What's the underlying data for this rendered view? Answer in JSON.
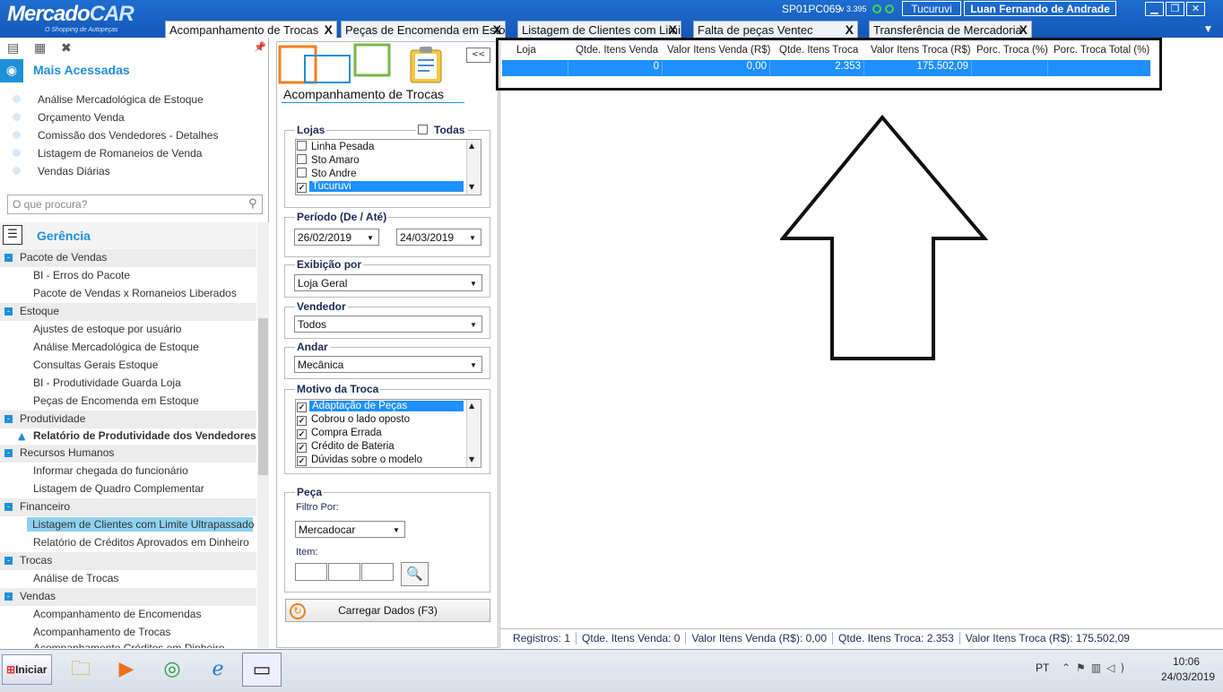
{
  "app": {
    "logo_main": "Mercado",
    "logo_car": "CAR",
    "logo_sub": "O Shopping de Autopeças"
  },
  "titlebar": {
    "pc_name": "SP01PC069",
    "version": "v 3.395",
    "store": "Tucuruvi",
    "user": "Luan Fernando de Andrade"
  },
  "tabs": [
    {
      "label": "Acompanhamento de Trocas",
      "active": true
    },
    {
      "label": "Peças de Encomenda em Estoq",
      "active": false
    },
    {
      "label": "Listagem de Clientes com Limi",
      "active": false
    },
    {
      "label": "Falta de peças Ventec",
      "active": false
    },
    {
      "label": "Transferência de Mercadoria",
      "active": false
    }
  ],
  "sidebar": {
    "most_accessed_title": "Mais Acessadas",
    "favorites": [
      "Análise Mercadológica de Estoque",
      "Orçamento Venda",
      "Comissão dos Vendedores - Detalhes",
      "Listagem de Romaneios de Venda",
      "Vendas Diárias"
    ],
    "search_placeholder": "O que procura?",
    "section_title": "Gerência",
    "groups": [
      {
        "name": "Pacote de Vendas",
        "items": [
          "BI - Erros do Pacote",
          "Pacote de Vendas x Romaneios Liberados"
        ]
      },
      {
        "name": "Estoque",
        "items": [
          "Ajustes de estoque por usuário",
          "Análise Mercadológica de Estoque",
          "Consultas Gerais Estoque",
          "BI - Produtividade Guarda Loja",
          "Peças de Encomenda em Estoque"
        ]
      },
      {
        "name": "Produtividade",
        "items": [
          "Relatório de Produtividade dos Vendedores"
        ]
      },
      {
        "name": "Recursos Humanos",
        "items": [
          "Informar chegada do funcionário",
          "Listagem de Quadro Complementar"
        ]
      },
      {
        "name": "Financeiro",
        "items": [
          "Listagem de Clientes com Limite Ultrapassado",
          "Relatório de Créditos Aprovados em Dinheiro"
        ]
      },
      {
        "name": "Trocas",
        "items": [
          "Análise de Trocas"
        ]
      },
      {
        "name": "Vendas",
        "items": [
          "Acompanhamento de Encomendas",
          "Acompanhamento de Trocas",
          "Acompanhamento Créditos em Dinheiro"
        ]
      }
    ]
  },
  "filters": {
    "title": "Acompanhamento de Trocas",
    "collapse_label": "<<",
    "stores_label": "Lojas",
    "all_label": "Todas",
    "stores": [
      {
        "name": "Linha Pesada",
        "checked": false
      },
      {
        "name": "Sto Amaro",
        "checked": false
      },
      {
        "name": "Sto Andre",
        "checked": false
      },
      {
        "name": "Tucuruvi",
        "checked": true
      }
    ],
    "period_label": "Período (De / Até)",
    "date_from": "26/02/2019",
    "date_to": "24/03/2019",
    "display_label": "Exibição por",
    "display_value": "Loja Geral",
    "seller_label": "Vendedor",
    "seller_value": "Todos",
    "floor_label": "Andar",
    "floor_value": "Mecânica",
    "reason_label": "Motivo da Troca",
    "reasons": [
      {
        "name": "Adaptação de Peças",
        "checked": true
      },
      {
        "name": "Cobrou o lado oposto",
        "checked": true
      },
      {
        "name": "Compra Errada",
        "checked": true
      },
      {
        "name": "Crédito de Bateria",
        "checked": true
      },
      {
        "name": "Dúvidas sobre o modelo",
        "checked": true
      }
    ],
    "part_label": "Peça",
    "filter_by_label": "Filtro Por:",
    "filter_by_value": "Mercadocar",
    "item_label": "Item:",
    "load_button": "Carregar Dados (F3)"
  },
  "grid": {
    "columns": [
      "Loja",
      "Qtde. Itens Venda",
      "Valor Itens Venda (R$)",
      "Qtde. Itens Troca",
      "Valor Itens Troca (R$)",
      "Porc. Troca (%)",
      "Porc. Troca Total (%)"
    ],
    "rows": [
      [
        "",
        "0",
        "0,00",
        "2.353",
        "175.502,09",
        "",
        ""
      ]
    ]
  },
  "statusbar": {
    "registros": "Registros: 1",
    "qtde_venda": "Qtde. Itens Venda: 0",
    "valor_venda": "Valor Itens Venda (R$): 0,00",
    "qtde_troca": "Qtde. Itens Troca: 2.353",
    "valor_troca": "Valor Itens Troca (R$): 175.502,09"
  },
  "taskbar": {
    "start_label": "Iniciar",
    "lang": "PT",
    "time": "10:06",
    "date": "24/03/2019"
  }
}
